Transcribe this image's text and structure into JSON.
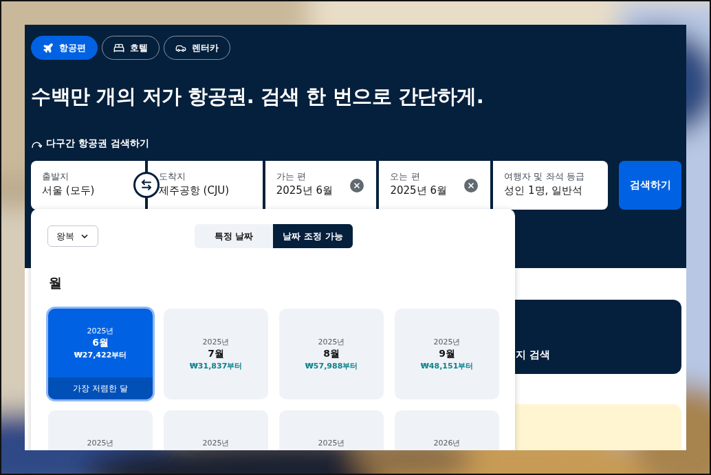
{
  "nav_tabs": [
    {
      "kind": "plane",
      "label": "항공편",
      "selected": true
    },
    {
      "kind": "bed",
      "label": "호텔",
      "selected": false
    },
    {
      "kind": "car",
      "label": "렌터카",
      "selected": false
    }
  ],
  "headline": "수백만 개의 저가 항공권. 검색 한 번으로 간단하게.",
  "multi_city_link": "다구간 항공권 검색하기",
  "search_fields": [
    {
      "label": "출발지",
      "value": "서울 (모두)",
      "clearable": false
    },
    {
      "label": "도착지",
      "value": "제주공항 (CJU)",
      "clearable": false
    },
    {
      "label": "가는 편",
      "value": "2025년 6월",
      "clearable": true
    },
    {
      "label": "오는 편",
      "value": "2025년 6월",
      "clearable": true
    },
    {
      "label": "여행자 및 좌석 등급",
      "value": "성인 1명, 일반석",
      "clearable": false
    }
  ],
  "search_button": "검색하기",
  "popup": {
    "trip_type": "왕복",
    "date_modes": [
      {
        "label": "특정 날짜",
        "selected": false
      },
      {
        "label": "날짜 조정 가능",
        "selected": true
      }
    ],
    "section_title": "월",
    "months": [
      {
        "year": "2025년",
        "month": "6월",
        "price": "₩27,422부터",
        "badge": "가장 저렴한 달",
        "selected": true
      },
      {
        "year": "2025년",
        "month": "7월",
        "price": "₩31,837부터",
        "selected": false
      },
      {
        "year": "2025년",
        "month": "8월",
        "price": "₩57,988부터",
        "selected": false
      },
      {
        "year": "2025년",
        "month": "9월",
        "price": "₩48,151부터",
        "selected": false
      },
      {
        "year": "2025년",
        "selected": false
      },
      {
        "year": "2025년",
        "selected": false
      },
      {
        "year": "2025년",
        "selected": false
      },
      {
        "year": "2026년",
        "selected": false
      }
    ]
  },
  "side_cards": [
    {
      "kind": "dark",
      "text": "지 검색"
    },
    {
      "kind": "yellow"
    }
  ]
}
